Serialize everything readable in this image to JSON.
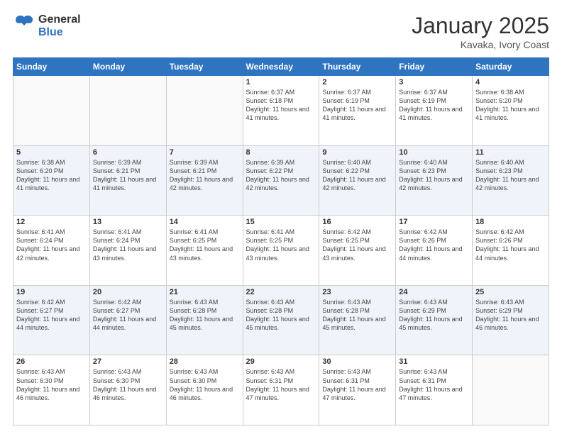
{
  "header": {
    "logo_general": "General",
    "logo_blue": "Blue",
    "month_year": "January 2025",
    "location": "Kavaka, Ivory Coast"
  },
  "days_of_week": [
    "Sunday",
    "Monday",
    "Tuesday",
    "Wednesday",
    "Thursday",
    "Friday",
    "Saturday"
  ],
  "weeks": [
    [
      {
        "day": "",
        "info": ""
      },
      {
        "day": "",
        "info": ""
      },
      {
        "day": "",
        "info": ""
      },
      {
        "day": "1",
        "info": "Sunrise: 6:37 AM\nSunset: 6:18 PM\nDaylight: 11 hours\nand 41 minutes."
      },
      {
        "day": "2",
        "info": "Sunrise: 6:37 AM\nSunset: 6:19 PM\nDaylight: 11 hours\nand 41 minutes."
      },
      {
        "day": "3",
        "info": "Sunrise: 6:37 AM\nSunset: 6:19 PM\nDaylight: 11 hours\nand 41 minutes."
      },
      {
        "day": "4",
        "info": "Sunrise: 6:38 AM\nSunset: 6:20 PM\nDaylight: 11 hours\nand 41 minutes."
      }
    ],
    [
      {
        "day": "5",
        "info": "Sunrise: 6:38 AM\nSunset: 6:20 PM\nDaylight: 11 hours\nand 41 minutes."
      },
      {
        "day": "6",
        "info": "Sunrise: 6:39 AM\nSunset: 6:21 PM\nDaylight: 11 hours\nand 41 minutes."
      },
      {
        "day": "7",
        "info": "Sunrise: 6:39 AM\nSunset: 6:21 PM\nDaylight: 11 hours\nand 42 minutes."
      },
      {
        "day": "8",
        "info": "Sunrise: 6:39 AM\nSunset: 6:22 PM\nDaylight: 11 hours\nand 42 minutes."
      },
      {
        "day": "9",
        "info": "Sunrise: 6:40 AM\nSunset: 6:22 PM\nDaylight: 11 hours\nand 42 minutes."
      },
      {
        "day": "10",
        "info": "Sunrise: 6:40 AM\nSunset: 6:23 PM\nDaylight: 11 hours\nand 42 minutes."
      },
      {
        "day": "11",
        "info": "Sunrise: 6:40 AM\nSunset: 6:23 PM\nDaylight: 11 hours\nand 42 minutes."
      }
    ],
    [
      {
        "day": "12",
        "info": "Sunrise: 6:41 AM\nSunset: 6:24 PM\nDaylight: 11 hours\nand 42 minutes."
      },
      {
        "day": "13",
        "info": "Sunrise: 6:41 AM\nSunset: 6:24 PM\nDaylight: 11 hours\nand 43 minutes."
      },
      {
        "day": "14",
        "info": "Sunrise: 6:41 AM\nSunset: 6:25 PM\nDaylight: 11 hours\nand 43 minutes."
      },
      {
        "day": "15",
        "info": "Sunrise: 6:41 AM\nSunset: 6:25 PM\nDaylight: 11 hours\nand 43 minutes."
      },
      {
        "day": "16",
        "info": "Sunrise: 6:42 AM\nSunset: 6:25 PM\nDaylight: 11 hours\nand 43 minutes."
      },
      {
        "day": "17",
        "info": "Sunrise: 6:42 AM\nSunset: 6:26 PM\nDaylight: 11 hours\nand 44 minutes."
      },
      {
        "day": "18",
        "info": "Sunrise: 6:42 AM\nSunset: 6:26 PM\nDaylight: 11 hours\nand 44 minutes."
      }
    ],
    [
      {
        "day": "19",
        "info": "Sunrise: 6:42 AM\nSunset: 6:27 PM\nDaylight: 11 hours\nand 44 minutes."
      },
      {
        "day": "20",
        "info": "Sunrise: 6:42 AM\nSunset: 6:27 PM\nDaylight: 11 hours\nand 44 minutes."
      },
      {
        "day": "21",
        "info": "Sunrise: 6:43 AM\nSunset: 6:28 PM\nDaylight: 11 hours\nand 45 minutes."
      },
      {
        "day": "22",
        "info": "Sunrise: 6:43 AM\nSunset: 6:28 PM\nDaylight: 11 hours\nand 45 minutes."
      },
      {
        "day": "23",
        "info": "Sunrise: 6:43 AM\nSunset: 6:28 PM\nDaylight: 11 hours\nand 45 minutes."
      },
      {
        "day": "24",
        "info": "Sunrise: 6:43 AM\nSunset: 6:29 PM\nDaylight: 11 hours\nand 45 minutes."
      },
      {
        "day": "25",
        "info": "Sunrise: 6:43 AM\nSunset: 6:29 PM\nDaylight: 11 hours\nand 46 minutes."
      }
    ],
    [
      {
        "day": "26",
        "info": "Sunrise: 6:43 AM\nSunset: 6:30 PM\nDaylight: 11 hours\nand 46 minutes."
      },
      {
        "day": "27",
        "info": "Sunrise: 6:43 AM\nSunset: 6:30 PM\nDaylight: 11 hours\nand 46 minutes."
      },
      {
        "day": "28",
        "info": "Sunrise: 6:43 AM\nSunset: 6:30 PM\nDaylight: 11 hours\nand 46 minutes."
      },
      {
        "day": "29",
        "info": "Sunrise: 6:43 AM\nSunset: 6:31 PM\nDaylight: 11 hours\nand 47 minutes."
      },
      {
        "day": "30",
        "info": "Sunrise: 6:43 AM\nSunset: 6:31 PM\nDaylight: 11 hours\nand 47 minutes."
      },
      {
        "day": "31",
        "info": "Sunrise: 6:43 AM\nSunset: 6:31 PM\nDaylight: 11 hours\nand 47 minutes."
      },
      {
        "day": "",
        "info": ""
      }
    ]
  ]
}
